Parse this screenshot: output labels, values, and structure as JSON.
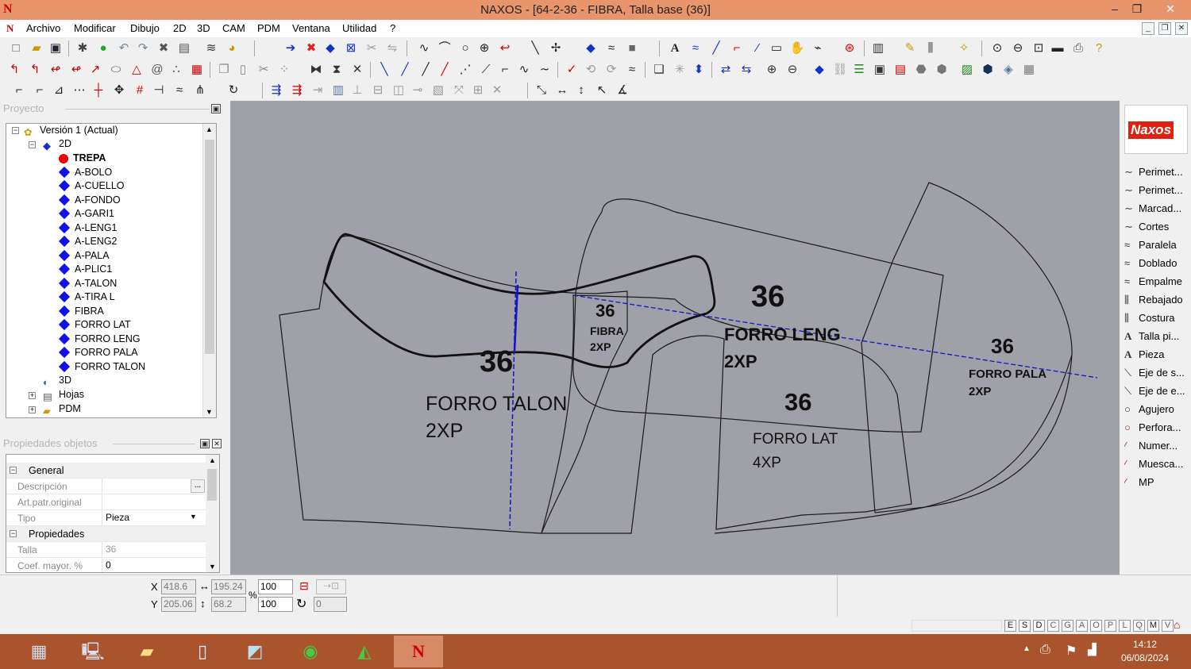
{
  "window": {
    "app_icon": "N",
    "title": "NAXOS - [64-2-36 - FIBRA, Talla base (36)]",
    "controls": [
      "–",
      "❐",
      "✕"
    ]
  },
  "menu": {
    "items": [
      "Archivo",
      "Modificar",
      "Dibujo",
      "2D",
      "3D",
      "CAM",
      "PDM",
      "Ventana",
      "Utilidad",
      "?"
    ]
  },
  "project_panel": {
    "title": "Proyecto",
    "tree": {
      "root": "Versión 1 (Actual)",
      "folder2d": "2D",
      "pieces": [
        "TREPA",
        "A-BOLO",
        "A-CUELLO",
        "A-FONDO",
        "A-GARI1",
        "A-LENG1",
        "A-LENG2",
        "A-PALA",
        "A-PLIC1",
        "A-TALON",
        "A-TIRA L",
        "FIBRA",
        "FORRO LAT",
        "FORRO LENG",
        "FORRO PALA",
        "FORRO TALON"
      ],
      "active_piece": "TREPA",
      "folder3d": "3D",
      "hojas": "Hojas",
      "pdm": "PDM"
    }
  },
  "props_panel": {
    "title": "Propiedades objetos",
    "general_group": "General",
    "descripcion_label": "Descripción",
    "descripcion_value": "",
    "descripcion_button": "...",
    "art_label": "Art.patr.original",
    "art_value": "",
    "tipo_label": "Tipo",
    "tipo_value": "Pieza",
    "propiedades_group": "Propiedades",
    "talla_label": "Talla",
    "talla_value": "36",
    "coef_label": "Coef. mayor. %",
    "coef_value": "0"
  },
  "canvas": {
    "labels": [
      {
        "size": "36",
        "name": "FORRO TALON",
        "qty": "2XP"
      },
      {
        "size": "36",
        "name": "FIBRA",
        "qty": "2XP"
      },
      {
        "size": "36",
        "name": "FORRO LENG",
        "qty": "2XP"
      },
      {
        "size": "36",
        "name": "FORRO LAT",
        "qty": "4XP"
      },
      {
        "size": "36",
        "name": "FORRO PALA",
        "qty": "2XP"
      }
    ]
  },
  "right_panel": {
    "logo": "Naxos",
    "items": [
      "Perimet...",
      "Perimet...",
      "Marcad...",
      "Cortes",
      "Paralela",
      "Doblado",
      "Empalme",
      "Rebajado",
      "Costura",
      "Talla pi...",
      "Pieza",
      "Eje de s...",
      "Eje de e...",
      "Agujero",
      "Perfora...",
      "Numer...",
      "Muesca...",
      "MP"
    ]
  },
  "coords": {
    "x_label": "X",
    "y_label": "Y",
    "x": "418.6",
    "y": "205.06",
    "width": "195.24",
    "height": "68.2",
    "scale_x": "100",
    "scale_y": "100",
    "percent": "%",
    "angle": "0"
  },
  "status_letters": [
    "E",
    "S",
    "D",
    "C",
    "G",
    "A",
    "O",
    "P",
    "L",
    "Q",
    "M",
    "V"
  ],
  "clock": {
    "time": "14:12",
    "date": "06/08/2024"
  }
}
